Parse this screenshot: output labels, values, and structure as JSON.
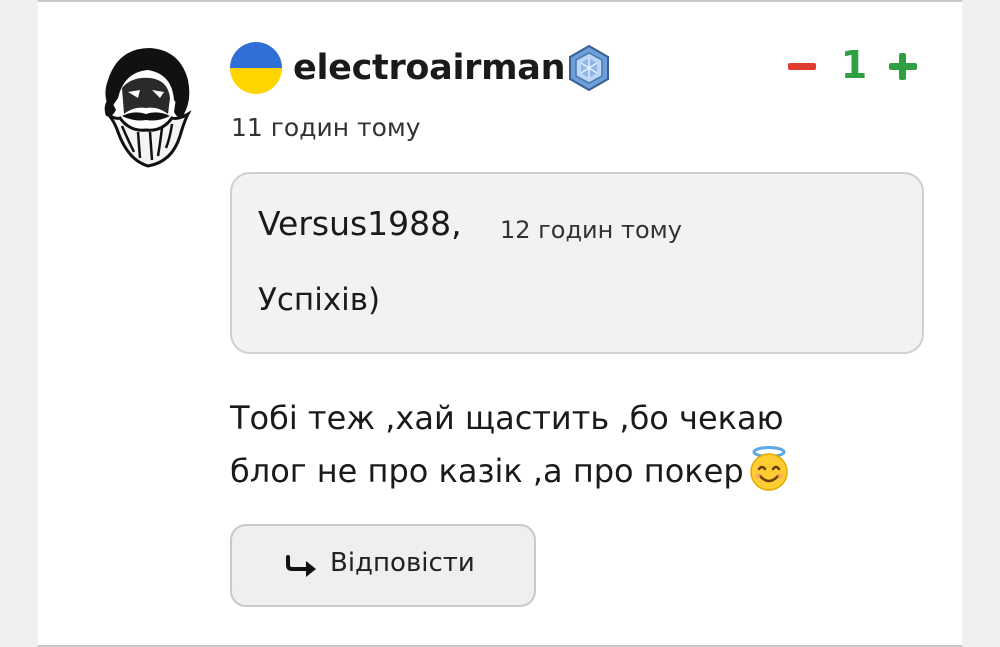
{
  "comment": {
    "author": {
      "username": "electroairman",
      "flag": "ukraine-flag",
      "badge": "crystal-badge-icon",
      "avatar": "bearded-man-portrait"
    },
    "timestamp": "11 годин тому",
    "votes": {
      "minus_icon": "minus-icon",
      "count": "1",
      "plus_icon": "plus-icon",
      "minus_color": "#e03c31",
      "plus_color": "#2ea043"
    },
    "quote": {
      "author": "Versus1988,",
      "time": "12 годин тому",
      "text": "Успіхів)"
    },
    "text_line1": "Тобі теж ,хай щастить ,бо чекаю",
    "text_line2": "блог не про казік ,а про покер",
    "emoji": "smiling-face-with-halo",
    "reply_button": {
      "icon": "reply-arrow-icon",
      "label": "Відповісти"
    }
  },
  "colors": {
    "flag_blue": "#2f6fd6",
    "flag_yellow": "#ffd500",
    "quote_bg": "#f2f2f2",
    "button_bg": "#efefef"
  }
}
